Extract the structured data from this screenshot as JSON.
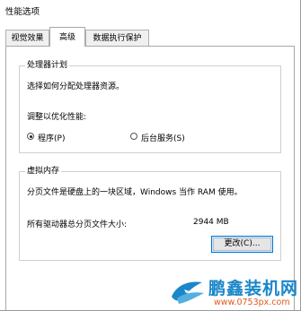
{
  "window": {
    "title": "性能选项"
  },
  "tabs": [
    {
      "label": "视觉效果",
      "active": false
    },
    {
      "label": "高级",
      "active": true
    },
    {
      "label": "数据执行保护",
      "active": false
    }
  ],
  "processor_group": {
    "title": "处理器计划",
    "description": "选择如何分配处理器资源。",
    "adjust_label": "调整以优化性能:",
    "options": [
      {
        "label": "程序(P)",
        "selected": true
      },
      {
        "label": "后台服务(S)",
        "selected": false
      }
    ]
  },
  "virtual_memory_group": {
    "title": "虚拟内存",
    "description": "分页文件是硬盘上的一块区域，Windows 当作 RAM 使用。",
    "total_label": "所有驱动器总分页文件大小:",
    "total_value": "2944 MB",
    "change_button": "更改(C)..."
  },
  "watermark": {
    "name": "鹏鑫装机网",
    "url": "www.0753px.com",
    "colors": {
      "name": "#1b87c9",
      "url": "#e05a1f"
    }
  }
}
